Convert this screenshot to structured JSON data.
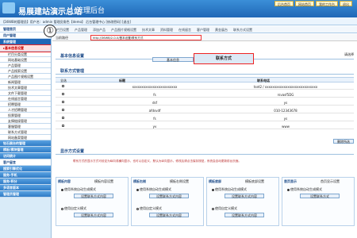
{
  "header": {
    "site_title": "易展建站演示总站",
    "mgmt_label": "管理后台",
    "top_buttons": [
      "后台首页",
      "网站首页",
      "我的工作台",
      "退出"
    ]
  },
  "infobar": {
    "text": "【36WB的管理员】用户名：admin 管理员角色【demo】 后台管理中心 [修改密码] [退出]"
  },
  "nav": {
    "items": [
      {
        "label": "管理首页",
        "type": "bluehdr"
      },
      {
        "label": "用户管理",
        "type": "bluehdr"
      },
      {
        "label": "系统管理",
        "type": "hl"
      },
      {
        "label": "▸基本信息设置",
        "type": "sel"
      },
      {
        "label": "栏目分类设置",
        "type": "sub"
      },
      {
        "label": "网站基础设置",
        "type": "sub"
      },
      {
        "label": "产品管理",
        "type": "sub"
      },
      {
        "label": "产品搜索设置",
        "type": "sub"
      },
      {
        "label": "产品图片规格设置",
        "type": "sub"
      },
      {
        "label": "新闻管理",
        "type": "sub"
      },
      {
        "label": "技术文章管理",
        "type": "sub"
      },
      {
        "label": "文件下载管理",
        "type": "sub"
      },
      {
        "label": "在线留言管理",
        "type": "sub"
      },
      {
        "label": "招聘管理",
        "type": "sub"
      },
      {
        "label": "人才招聘管理",
        "type": "sub"
      },
      {
        "label": "投票管理",
        "type": "sub"
      },
      {
        "label": "友情链接管理",
        "type": "sub"
      },
      {
        "label": "客服管理",
        "type": "sub"
      },
      {
        "label": "联系方式管理",
        "type": "sub"
      },
      {
        "label": "网站备案管理",
        "type": "sub"
      },
      {
        "label": "钻石展台的管理",
        "type": "group"
      },
      {
        "label": "模板/模块管理",
        "type": "group"
      },
      {
        "label": "访问统计",
        "type": "group"
      },
      {
        "label": "客户留言",
        "type": "bluehdr"
      },
      {
        "label": "搜索引擎优化",
        "type": "group"
      },
      {
        "label": "服务-手机",
        "type": "group"
      },
      {
        "label": "服务-积分",
        "type": "group"
      },
      {
        "label": "多语言版本",
        "type": "group"
      },
      {
        "label": "管理员管理",
        "type": "group"
      }
    ]
  },
  "tabs": [
    "栏目设置",
    "产品管理",
    "添加产品",
    "产品图片规格设置",
    "技术文章",
    "资料管理",
    "在线留言",
    "客户管理",
    "黄金展台",
    "联系方式设置"
  ],
  "addrbar": {
    "label": "当前路径",
    "value": "http://36WB/2-0-0/基本设置/联系方式"
  },
  "main": {
    "info_title": "基本信息设置",
    "sub_btn1": "基本信息",
    "sub_btn2": "联系方式",
    "right_label": "请选择",
    "contact_title": "联系方式管理",
    "table_headers": [
      "全选",
      "标题",
      "联系电话"
    ],
    "rows": [
      {
        "title": "xxxxxxxxxxxxxxxxxxxxxxxx",
        "phone": "tset2 / xxxxxxxxxxxxxxxxxxxxxxxxxxxx"
      },
      {
        "title": "fs",
        "phone": "rsvasf5DG"
      },
      {
        "title": "dsf",
        "phone": "ys"
      },
      {
        "title": "afdsvdf",
        "phone": "010-12343678"
      },
      {
        "title": "fs",
        "phone": "ys"
      },
      {
        "title": "yv",
        "phone": "www"
      }
    ],
    "del_btn": "删除所选",
    "style_title": "显示方式设置",
    "notice": "联系方式的显示方式可设定为纵向或横向显示，也可以自定义，默认为纵向显示。修改后请点击保存按钮，系统会自动更新前台页面。",
    "panels": [
      {
        "title": "模板内容",
        "label": "模板内容设置",
        "opts": [
          "使用系统自动生成模式",
          "使用自定义模式"
        ],
        "btn": "设置联系方式内容"
      },
      {
        "title": "模板右侧",
        "label": "模板右侧设置",
        "opts": [
          "使用系统自动生成模式",
          "使用自定义模式"
        ],
        "btn": "设置联系方式内容"
      },
      {
        "title": "模板底部",
        "label": "模板底部设置",
        "opts": [
          "使用系统自动生成模式",
          "使用自定义模式"
        ],
        "btn": "设置联系方式内容"
      },
      {
        "title": "首页显示",
        "label": "首页显示设置",
        "opts": [
          "使用系统自动生成模式"
        ],
        "btn": "设置联系方式"
      }
    ]
  },
  "callouts": [
    "①",
    "②",
    "③"
  ]
}
